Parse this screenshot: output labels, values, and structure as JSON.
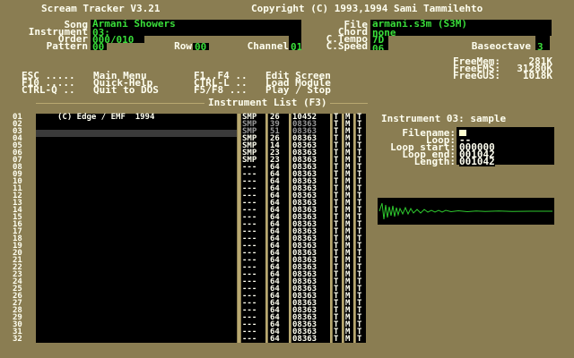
{
  "header": {
    "app_title": "Scream Tracker V3.21",
    "copyright": "Copyright (C) 1993,1994 Sami Tammilehto"
  },
  "song_info": {
    "song_label": "Song",
    "song_value": "Armani Showers",
    "instrument_label": "Instrument",
    "instrument_value": "03:",
    "order_label": "Order",
    "order_value": "000/010",
    "pattern_label": "Pattern",
    "pattern_value": "00",
    "row_label": "Row",
    "row_value": "00",
    "channel_label": "Channel",
    "channel_value": "01",
    "file_label": "File",
    "file_value": "armani.s3m (S3M)",
    "chord_label": "Chord",
    "chord_value": "none",
    "ctempo_label": "C.Tempo",
    "ctempo_value": "7D",
    "cspeed_label": "C.Speed",
    "cspeed_value": "06",
    "baseoctave_label": "Baseoctave",
    "baseoctave_value": "3"
  },
  "help": {
    "line1_key": "ESC .....",
    "line1_action": "Main Menu",
    "line2_key": "F10 .....",
    "line2_action": "Quick-Help",
    "line3_key": "CTRL-Q ..",
    "line3_action": "Quit to DOS",
    "line1b_key": "F1..F4 ..",
    "line1b_action": "Edit Screen",
    "line2b_key": "CTRL-L ..",
    "line2b_action": "Load Module",
    "line3b_key": "F5/F8 ...",
    "line3b_action": "Play / Stop"
  },
  "memory": {
    "freemem_label": "FreeMem:",
    "freemem_value": "281K",
    "freeems_label": "FreeEMS:",
    "freeems_value": "31280K",
    "freegus_label": "FreeGUS:",
    "freegus_value": "1018K"
  },
  "instrument_list": {
    "title": "Instrument List (F3)",
    "row_numbers": [
      "01",
      "02",
      "03",
      "04",
      "05",
      "06",
      "07",
      "08",
      "09",
      "10",
      "11",
      "12",
      "13",
      "14",
      "15",
      "16",
      "17",
      "18",
      "19",
      "20",
      "21",
      "22",
      "23",
      "24",
      "25",
      "26",
      "27",
      "28",
      "29",
      "30",
      "31",
      "32"
    ],
    "names": [
      "(C) Edge / EMF  1994",
      "",
      "",
      "",
      "",
      "",
      "",
      "",
      "",
      "",
      "",
      "",
      "",
      "",
      "",
      "",
      "",
      "",
      "",
      "",
      "",
      "",
      "",
      "",
      "",
      "",
      "",
      "",
      "",
      "",
      "",
      ""
    ],
    "types": [
      "SMP",
      "SMP",
      "SMP",
      "SMP",
      "SMP",
      "SMP",
      "SMP",
      "---",
      "---",
      "---",
      "---",
      "---",
      "---",
      "---",
      "---",
      "---",
      "---",
      "---",
      "---",
      "---",
      "---",
      "---",
      "---",
      "---",
      "---",
      "---",
      "---",
      "---",
      "---",
      "---",
      "---",
      "---"
    ],
    "volumes": [
      "26",
      "39",
      "51",
      "26",
      "14",
      "23",
      "23",
      "64",
      "64",
      "64",
      "64",
      "64",
      "64",
      "64",
      "64",
      "64",
      "64",
      "64",
      "64",
      "64",
      "64",
      "64",
      "64",
      "64",
      "64",
      "64",
      "64",
      "64",
      "64",
      "64",
      "64",
      "64"
    ],
    "c2spd": [
      "10452",
      "08363",
      "08363",
      "08363",
      "08363",
      "08363",
      "08363",
      "08363",
      "08363",
      "08363",
      "08363",
      "08363",
      "08363",
      "08363",
      "08363",
      "08363",
      "08363",
      "08363",
      "08363",
      "08363",
      "08363",
      "08363",
      "08363",
      "08363",
      "08363",
      "08363",
      "08363",
      "08363",
      "08363",
      "08363",
      "08363",
      "08363"
    ],
    "flag_t": "T",
    "flag_m": "M"
  },
  "instrument_detail": {
    "title": "Instrument 03: sample",
    "filename_label": "Filename:",
    "filename_value": "",
    "loop_label": "Loop:",
    "loop_value": "--",
    "loopstart_label": "Loop start:",
    "loopstart_value": "000000",
    "loopend_label": "Loop end:",
    "loopend_value": "001042",
    "length_label": "Length:",
    "length_value": "001042"
  },
  "colors": {
    "background": "#8a7d52",
    "panel": "#000000",
    "text": "#fffff0",
    "field_text": "#3ade3a",
    "waveform": "#2ec82e"
  }
}
